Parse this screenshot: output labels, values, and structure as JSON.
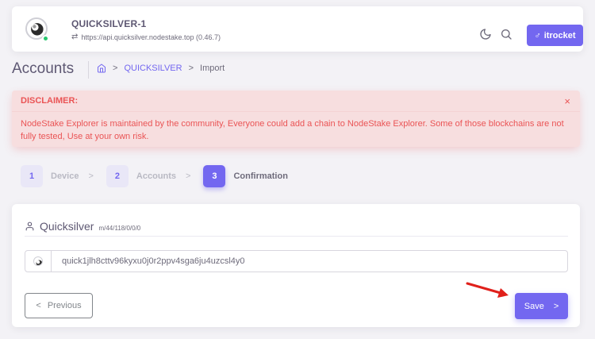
{
  "header": {
    "chain_name": "QUICKSILVER-1",
    "endpoint": "https://api.quicksilver.nodestake.top (0.46.7)",
    "user_button_label": "itrocket",
    "user_button_icon": "male-symbol-icon"
  },
  "page": {
    "title": "Accounts",
    "breadcrumb": {
      "home_icon": "home-icon",
      "items": [
        "QUICKSILVER",
        "Import"
      ],
      "separator": ">"
    }
  },
  "alert": {
    "heading": "DISCLAIMER:",
    "close_label": "×",
    "body": "NodeStake Explorer is maintained by the community, Everyone could add a chain to NodeStake Explorer. Some of those blockchains are not fully tested, Use at your own risk."
  },
  "stepper": {
    "steps": [
      {
        "number": "1",
        "label": "Device"
      },
      {
        "number": "2",
        "label": "Accounts"
      },
      {
        "number": "3",
        "label": "Confirmation"
      }
    ],
    "separator": ">",
    "active_step": 3
  },
  "account_card": {
    "title": "Quicksilver",
    "hd_path": "m/44/118/0/0/0",
    "address": "quick1jlh8cttv96kyxu0j0r2ppv4sga6ju4uzcsl4y0",
    "previous_label": "Previous",
    "previous_icon": "<",
    "save_label": "Save",
    "save_icon": ">"
  },
  "colors": {
    "primary": "#7367f0",
    "danger": "#ea5455",
    "success": "#28c76f",
    "annotation_arrow": "#e0201b"
  }
}
